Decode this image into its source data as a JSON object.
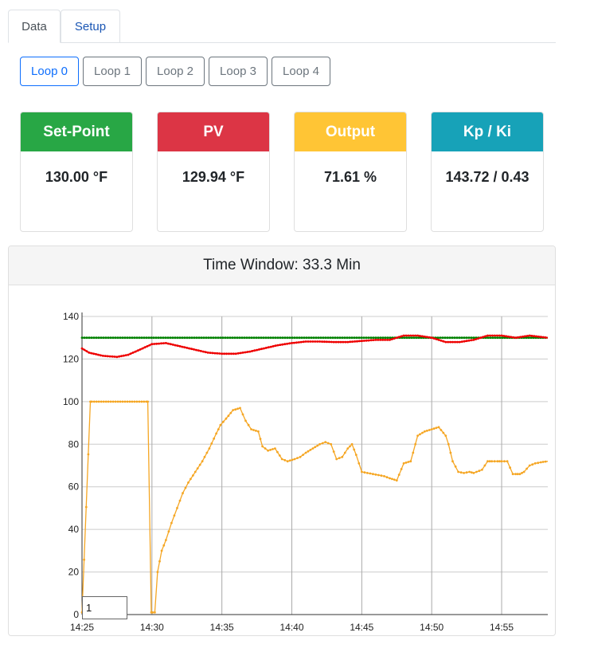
{
  "tabs": [
    {
      "label": "Data",
      "active": true
    },
    {
      "label": "Setup",
      "active": false
    }
  ],
  "loops": [
    "Loop 0",
    "Loop 1",
    "Loop 2",
    "Loop 3",
    "Loop 4"
  ],
  "selected_loop": "Loop 0",
  "cards": [
    {
      "title": "Set-Point",
      "value": "130.00 °F",
      "color": "#28a745"
    },
    {
      "title": "PV",
      "value": "129.94 °F",
      "color": "#dc3545"
    },
    {
      "title": "Output",
      "value": "71.61 %",
      "color": "#ffc535"
    },
    {
      "title": "Kp / Ki",
      "value": "143.72 / 0.43",
      "color": "#17a2b8"
    }
  ],
  "chart_panel": {
    "title": "Time Window: 33.3 Min",
    "range_input_value": "1"
  },
  "chart_data": {
    "type": "line",
    "x_ticks": [
      "14:25",
      "14:30",
      "14:35",
      "14:40",
      "14:45",
      "14:50",
      "14:55"
    ],
    "y_ticks": [
      0,
      20,
      40,
      60,
      80,
      100,
      140
    ],
    "y_tick_labels": [
      "0",
      "20",
      "40",
      "60",
      "80",
      "100",
      "120",
      "140"
    ],
    "xlim_minutes": [
      0,
      33.3
    ],
    "ylim": [
      0,
      140
    ],
    "grid": true,
    "series": [
      {
        "color": "#008000",
        "x": [
          0,
          33.3
        ],
        "values": [
          130,
          130
        ]
      },
      {
        "color": "#ee0000",
        "x": [
          0,
          0.5,
          1.5,
          2.5,
          3.3,
          4,
          5,
          6,
          7,
          8,
          9,
          10,
          11,
          12,
          13,
          14,
          15,
          16,
          17,
          18,
          19,
          20,
          21,
          22,
          23,
          24,
          25,
          26,
          27,
          28,
          29,
          30,
          31,
          32,
          33.3
        ],
        "values": [
          125,
          123,
          121.5,
          121,
          122,
          124,
          127,
          127.5,
          126,
          124.5,
          123,
          122.5,
          122.5,
          123.5,
          125,
          126.5,
          127.5,
          128.2,
          128.2,
          128,
          128,
          128.5,
          129,
          129,
          131,
          131,
          130,
          128,
          128,
          129,
          131,
          131,
          130,
          131,
          130
        ]
      },
      {
        "color": "#f5a623",
        "x": [
          0,
          0.6,
          0.7,
          4.6,
          4.7,
          4.95,
          5.05,
          5.2,
          5.4,
          5.7,
          6.0,
          6.4,
          6.8,
          7.2,
          7.6,
          8.1,
          8.6,
          9.1,
          9.6,
          9.9,
          10.3,
          10.8,
          11.3,
          11.7,
          12.1,
          12.6,
          12.9,
          13.3,
          13.8,
          14.3,
          14.7,
          15.2,
          15.6,
          16.0,
          16.5,
          17.0,
          17.4,
          17.8,
          18.2,
          18.6,
          19.0,
          19.3,
          19.6,
          20.0,
          20.4,
          20.8,
          21.2,
          21.6,
          22.0,
          22.5,
          23.0,
          23.5,
          24.0,
          24.5,
          25.0,
          25.5,
          26.0,
          26.2,
          26.5,
          26.9,
          27.3,
          27.7,
          28.0,
          28.2,
          28.6,
          29.0,
          29.3,
          29.7,
          30.0,
          30.4,
          30.8,
          31.0,
          31.3,
          31.6,
          32.0,
          32.4,
          32.8,
          33.3
        ],
        "values": [
          1,
          100,
          100,
          100,
          100,
          1,
          1,
          1,
          20,
          30,
          35,
          43,
          50,
          57,
          62,
          67,
          72,
          78,
          85,
          89,
          92,
          96,
          97,
          91,
          87,
          86,
          79,
          77,
          78,
          73,
          72,
          73,
          74,
          76,
          78,
          80,
          81,
          80,
          73,
          74,
          78,
          80,
          75,
          67,
          66.5,
          66,
          65.5,
          65,
          64,
          63,
          71,
          72,
          84,
          86,
          87,
          88,
          84,
          80,
          72,
          67,
          66.5,
          67,
          66.5,
          67,
          68,
          72,
          72,
          72,
          72,
          72,
          66,
          66,
          66,
          67,
          70,
          71,
          71.5,
          72
        ]
      }
    ]
  }
}
